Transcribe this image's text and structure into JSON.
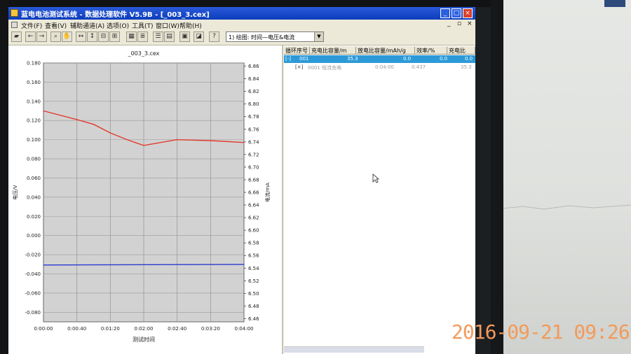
{
  "window": {
    "title": "蓝电电池测试系统 - 数据处理软件 V5.9B - [_003_3.cex]",
    "buttons": {
      "minimize": "_",
      "maximize": "□",
      "close": "×"
    }
  },
  "menu": {
    "items": [
      "文件(F)",
      "查看(V)",
      "辅助通道(A)",
      "选项(O)",
      "工具(T)",
      "窗口(W)",
      "帮助(H)"
    ],
    "doc_controls": {
      "minimize": "_",
      "restore": "▫",
      "close": "×"
    }
  },
  "toolbar": {
    "plot_select_value": "1) 绘图: 时间—电压&电流",
    "dropdown_arrow": "▼",
    "icons": [
      "open-icon",
      "back-icon",
      "forward-icon",
      "zoom-icon",
      "pan-icon",
      "fit-x-icon",
      "fit-y-icon",
      "fit-both-icon",
      "fit-all-icon",
      "grid-icon",
      "list-icon",
      "table-icon",
      "calc-icon",
      "save-icon",
      "chart-icon",
      "info-icon"
    ]
  },
  "chart_data": {
    "type": "line",
    "title": "_003_3.cex",
    "xlabel": "测试时间",
    "ylabel": "电压/V",
    "y2label": "电流/mA",
    "x_ticks": [
      "0:00:00",
      "0:00:40",
      "0:01:20",
      "0:02:00",
      "0:02:40",
      "0:03:20",
      "0:04:00"
    ],
    "y_ticks": [
      "0.180",
      "0.160",
      "0.140",
      "0.120",
      "0.100",
      "0.080",
      "0.060",
      "0.040",
      "0.020",
      "0.000",
      "-0.020",
      "-0.040",
      "-0.060",
      "-0.080"
    ],
    "y2_ticks": [
      "6.86",
      "6.84",
      "6.82",
      "6.80",
      "6.78",
      "6.76",
      "6.74",
      "6.72",
      "6.70",
      "6.68",
      "6.66",
      "6.64",
      "6.62",
      "6.60",
      "6.58",
      "6.56",
      "6.54",
      "6.52",
      "6.50",
      "6.48",
      "6.46"
    ],
    "ylim": [
      -0.09,
      0.18
    ],
    "y2lim": [
      6.455,
      6.865
    ],
    "xlim_seconds": [
      0,
      240
    ],
    "grid": true,
    "series": [
      {
        "name": "电压",
        "axis": "left",
        "color": "#e23a2e",
        "x": [
          0,
          40,
          60,
          80,
          100,
          120,
          160,
          200,
          240
        ],
        "y": [
          0.13,
          0.121,
          0.116,
          0.107,
          0.1,
          0.094,
          0.1,
          0.099,
          0.097
        ]
      },
      {
        "name": "电流",
        "axis": "right",
        "color": "#2a3ad0",
        "x": [
          0,
          240
        ],
        "y": [
          6.545,
          6.546
        ]
      }
    ]
  },
  "grid": {
    "headers": [
      "循环序号",
      "充电比容量/m",
      "放电比容量/mAh/g",
      "效率/%",
      "充电比"
    ],
    "rows": [
      {
        "toggle": "[-]",
        "cycle": "001",
        "charge": "35.3",
        "discharge": "0.0",
        "eff": "0.0",
        "extra": "0.0",
        "selected": true
      },
      {
        "toggle": "[+]",
        "cycle": "0001 恒流充电",
        "charge": "0:04:00",
        "discharge": "0.437",
        "eff": "35.3",
        "selected": false
      }
    ]
  },
  "photo_timestamp": "2016-09-21 09:26",
  "colors": {
    "titlebar": "#0b3dbd",
    "selection": "#2c9ad8",
    "voltage": "#e23a2e",
    "current": "#2a3ad0",
    "timestamp": "#f39a5a"
  }
}
